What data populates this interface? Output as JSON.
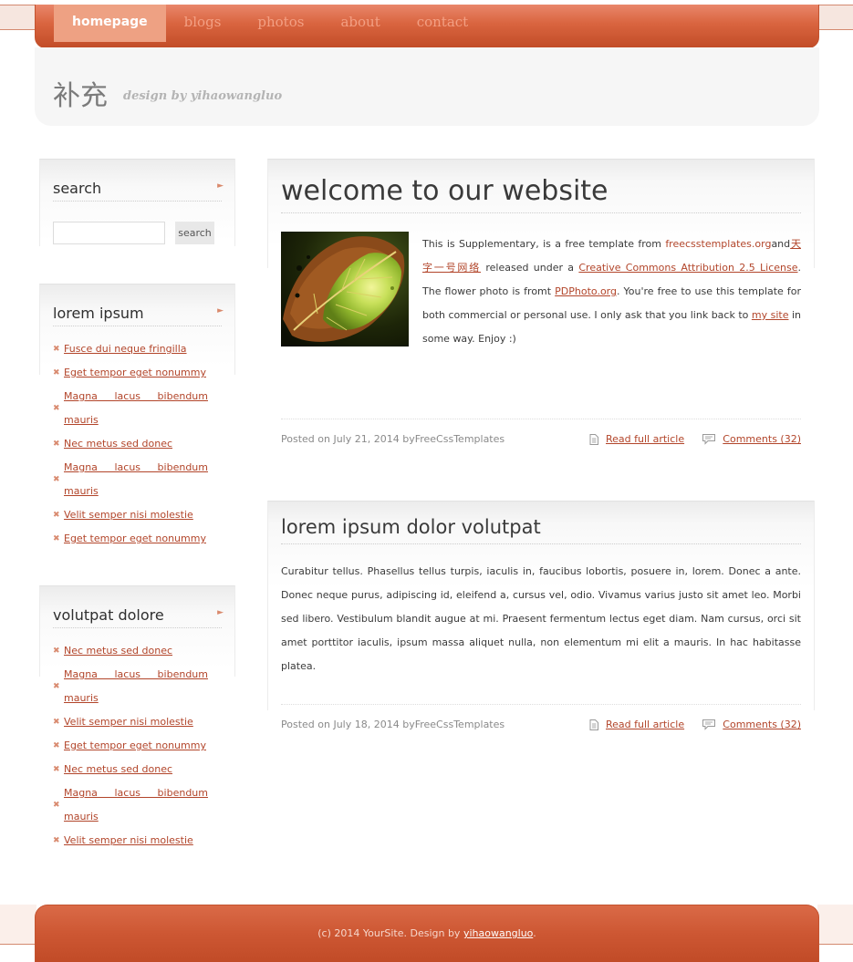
{
  "nav": {
    "items": [
      {
        "label": "homepage",
        "active": true
      },
      {
        "label": "blogs",
        "active": false
      },
      {
        "label": "photos",
        "active": false
      },
      {
        "label": "about",
        "active": false
      },
      {
        "label": "contact",
        "active": false
      }
    ]
  },
  "header": {
    "title": "补充",
    "subtitle": "design by yihaowangluo"
  },
  "sidebar": {
    "search": {
      "title": "search",
      "input_value": "",
      "button_label": "search"
    },
    "lorem": {
      "title": "lorem ipsum",
      "items": [
        "Fusce dui neque fringilla",
        "Eget tempor eget nonummy",
        "Magna lacus bibendum mauris",
        "Nec metus sed donec",
        "Magna lacus bibendum mauris",
        "Velit semper nisi molestie",
        "Eget tempor eget nonummy"
      ]
    },
    "volutpat": {
      "title": "volutpat dolore",
      "items": [
        "Nec metus sed donec",
        "Magna lacus bibendum mauris",
        "Velit semper nisi molestie",
        "Eget tempor eget nonummy",
        "Nec metus sed donec",
        "Magna lacus bibendum mauris",
        "Velit semper nisi molestie"
      ]
    }
  },
  "posts": [
    {
      "title": "welcome to our website",
      "body": {
        "t1": "This is Supplementary, is a free template from ",
        "l1": "freecsstemplates.org",
        "t2": "and",
        "l2": "天字一号网络",
        "t3": " released under a ",
        "l3": "Creative Commons Attribution 2.5 License",
        "t4": ". The flower photo is fromt ",
        "l4": "PDPhoto.org",
        "t5": ". You're free to use this template for both commercial or personal use. I only ask that you link back to ",
        "l5": "my site",
        "t6": " in some way. Enjoy :)"
      },
      "posted": "Posted on July 21, 2014 byFreeCssTemplates",
      "read_more": "Read full article",
      "comments": "Comments (32)"
    },
    {
      "title": "lorem ipsum dolor volutpat",
      "body": "Curabitur tellus. Phasellus tellus turpis, iaculis in, faucibus lobortis, posuere in, lorem. Donec a ante. Donec neque purus, adipiscing id, eleifend a, cursus vel, odio. Vivamus varius justo sit amet leo. Morbi sed libero. Vestibulum blandit augue at mi. Praesent fermentum lectus eget diam. Nam cursus, orci sit amet porttitor iaculis, ipsum massa aliquet nulla, non elementum mi elit a mauris. In hac habitasse platea.",
      "posted": "Posted on July 18, 2014 byFreeCssTemplates",
      "read_more": "Read full article",
      "comments": "Comments (32)"
    }
  ],
  "footer": {
    "text": "(c) 2014 YourSite. Design by ",
    "link": "yihaowangluo",
    "end": "."
  },
  "colors": {
    "accent": "#d9643f",
    "link": "#b2452a",
    "header_bg": "#f6f6f6"
  },
  "icons": {
    "bullet": "x-bullet-icon",
    "heading_arrow": "arrow-right-icon",
    "article": "document-icon",
    "comments": "comment-icon"
  }
}
